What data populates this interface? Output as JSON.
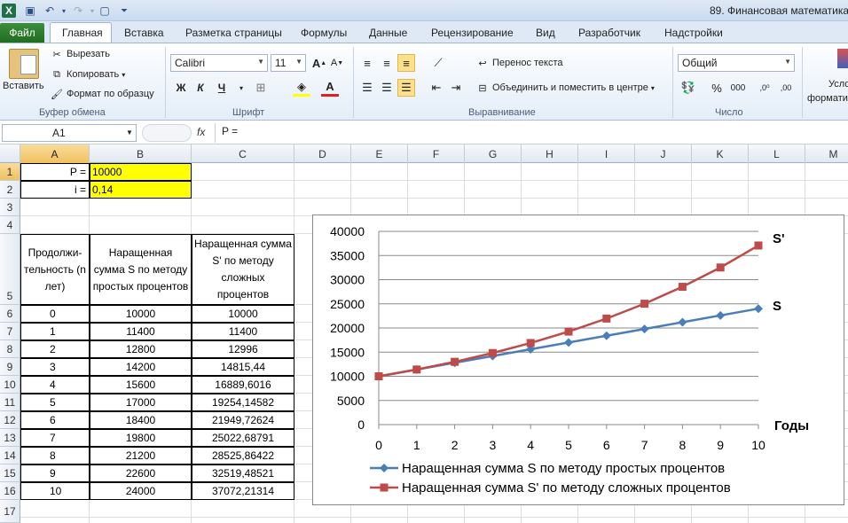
{
  "window": {
    "title": "89. Финансовая математика,"
  },
  "tabs": {
    "file": "Файл",
    "items": [
      "Главная",
      "Вставка",
      "Разметка страницы",
      "Формулы",
      "Данные",
      "Рецензирование",
      "Вид",
      "Разработчик",
      "Надстройки"
    ]
  },
  "ribbon": {
    "clipboard": {
      "paste": "Вставить",
      "cut": "Вырезать",
      "copy": "Копировать",
      "format_painter": "Формат по образцу",
      "label": "Буфер обмена"
    },
    "font": {
      "name": "Calibri",
      "size": "11",
      "bold": "Ж",
      "italic": "К",
      "underline": "Ч",
      "label": "Шрифт"
    },
    "alignment": {
      "wrap": "Перенос текста",
      "merge": "Объединить и поместить в центре",
      "label": "Выравнивание"
    },
    "number": {
      "format": "Общий",
      "percent": "%",
      "thousands": "000",
      "label": "Число"
    },
    "styles": {
      "cond1": "Усло",
      "cond2": "формати"
    }
  },
  "formula_bar": {
    "name_box": "A1",
    "fx": "fx",
    "formula": "P ="
  },
  "columns": [
    "A",
    "B",
    "C",
    "D",
    "E",
    "F",
    "G",
    "H",
    "I",
    "J",
    "K",
    "L",
    "M"
  ],
  "rows": [
    "1",
    "2",
    "3",
    "4",
    "5",
    "6",
    "7",
    "8",
    "9",
    "10",
    "11",
    "12",
    "13",
    "14",
    "15",
    "16",
    "17"
  ],
  "cells": {
    "a1": "P =",
    "b1": "10000",
    "a2": "i =",
    "b2": "0,14",
    "a5": "Продолжи-тельность (n лет)",
    "b5": "Наращенная сумма S по методу простых процентов",
    "c5": "Наращенная сумма S' по методу сложных процентов",
    "table": [
      [
        "0",
        "10000",
        "10000"
      ],
      [
        "1",
        "11400",
        "11400"
      ],
      [
        "2",
        "12800",
        "12996"
      ],
      [
        "3",
        "14200",
        "14815,44"
      ],
      [
        "4",
        "15600",
        "16889,6016"
      ],
      [
        "5",
        "17000",
        "19254,14582"
      ],
      [
        "6",
        "18400",
        "21949,72624"
      ],
      [
        "7",
        "19800",
        "25022,68791"
      ],
      [
        "8",
        "21200",
        "28525,86422"
      ],
      [
        "9",
        "22600",
        "32519,48521"
      ],
      [
        "10",
        "24000",
        "37072,21314"
      ]
    ]
  },
  "colors": {
    "simple": "#4a7ebb",
    "compound": "#be4b48",
    "highlight": "#ffff00"
  },
  "chart_data": {
    "type": "line",
    "x": [
      0,
      1,
      2,
      3,
      4,
      5,
      6,
      7,
      8,
      9,
      10
    ],
    "xlabel": "Годы",
    "ylim": [
      0,
      40000
    ],
    "yticks": [
      "0",
      "5000",
      "10000",
      "15000",
      "20000",
      "25000",
      "30000",
      "35000",
      "40000"
    ],
    "xticks": [
      "0",
      "1",
      "2",
      "3",
      "4",
      "5",
      "6",
      "7",
      "8",
      "9",
      "10"
    ],
    "grid": true,
    "legend": "bottom",
    "series": [
      {
        "name": "Наращенная сумма S по методу простых процентов",
        "label": "S",
        "values": [
          10000,
          11400,
          12800,
          14200,
          15600,
          17000,
          18400,
          19800,
          21200,
          22600,
          24000
        ]
      },
      {
        "name": "Наращенная сумма S' по методу сложных процентов",
        "label": "S'",
        "values": [
          10000,
          11400,
          12996,
          14815.44,
          16889.6,
          19254.15,
          21949.73,
          25022.69,
          28525.86,
          32519.49,
          37072.21
        ]
      }
    ]
  }
}
